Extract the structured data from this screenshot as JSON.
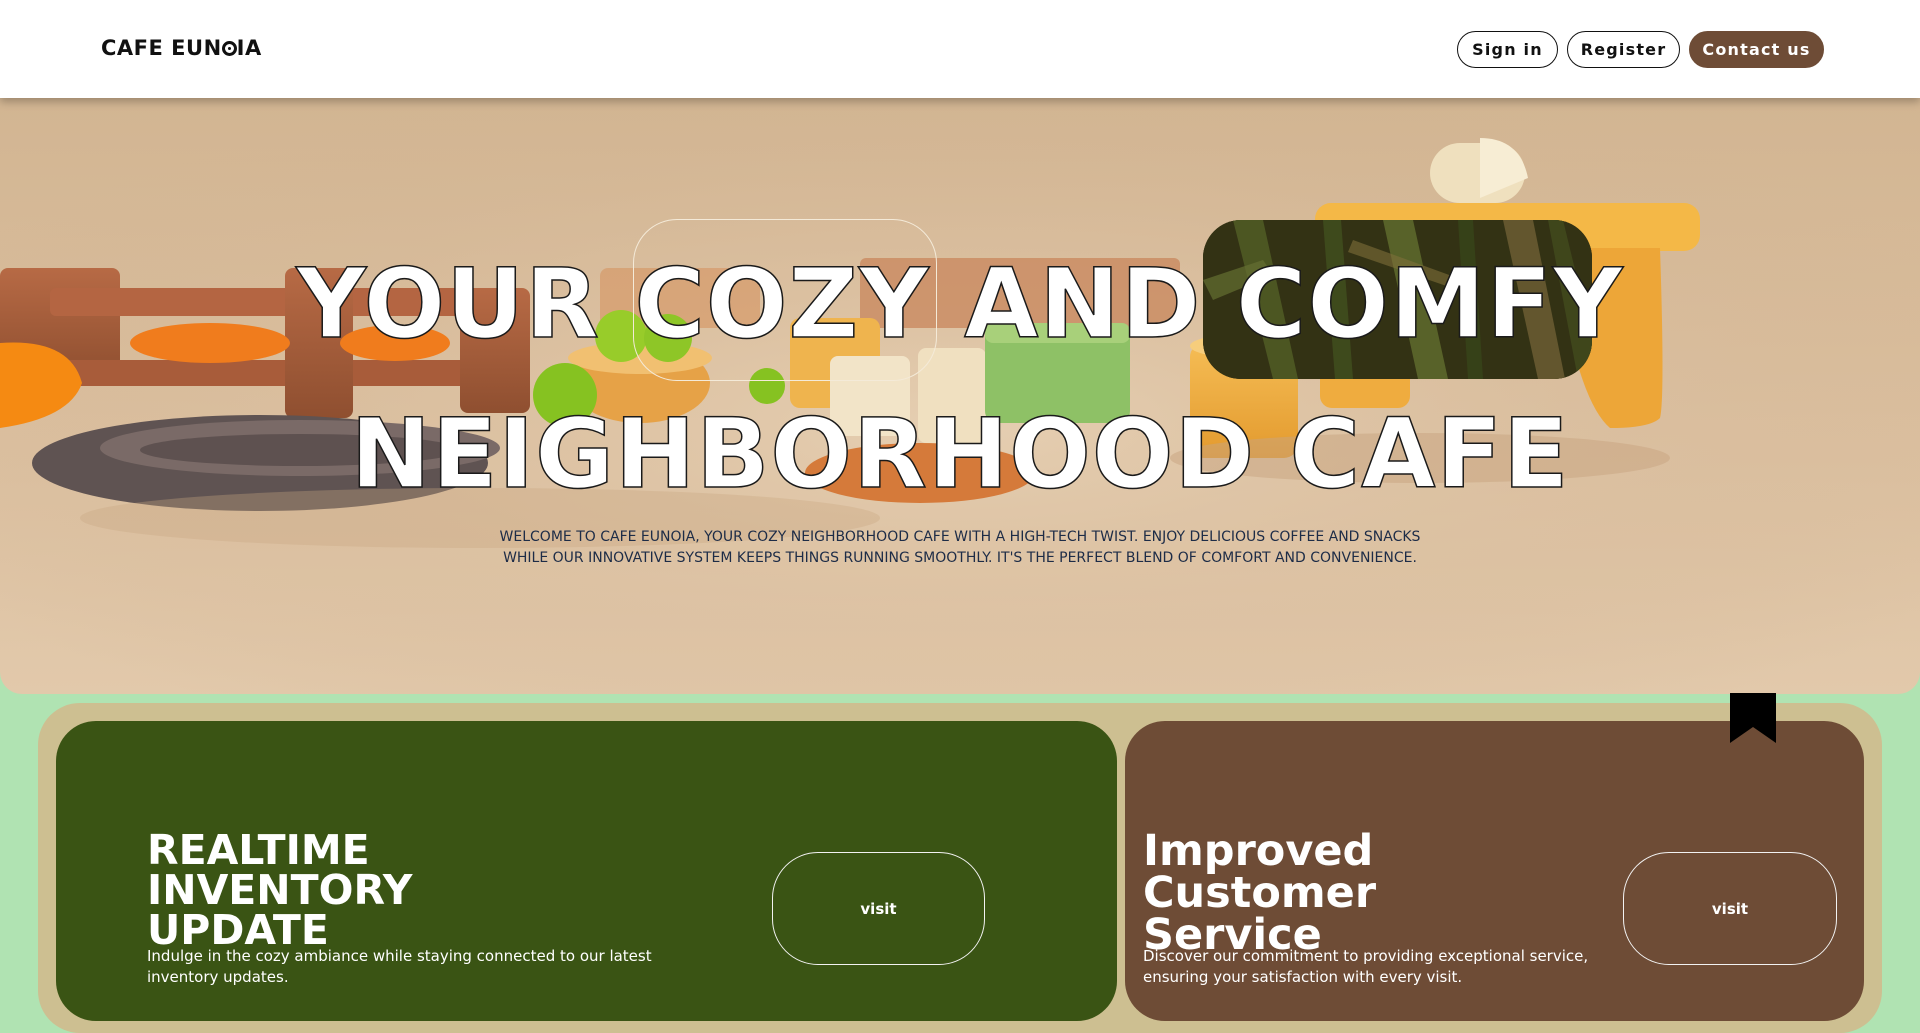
{
  "header": {
    "logo_prefix": "CAFE EUN",
    "logo_suffix": "IA",
    "signin_label": "Sign in",
    "register_label": "Register",
    "contact_label": "Contact us",
    "accent": "#6e4c36"
  },
  "hero": {
    "line1": "YOUR COZY AND COMFY",
    "line2": "NEIGHBORHOOD CAFE",
    "tagline": "WELCOME TO CAFE EUNOIA, YOUR COZY NEIGHBORHOOD CAFE WITH A HIGH-TECH TWIST. ENJOY DELICIOUS COFFEE AND SNACKS WHILE OUR INNOVATIVE SYSTEM KEEPS THINGS RUNNING SMOOTHLY. IT'S THE PERFECT BLEND OF COMFORT AND CONVENIENCE."
  },
  "cards": [
    {
      "title_lines": [
        "REALTIME",
        "INVENTORY",
        "UPDATE"
      ],
      "description": "Indulge in the cozy ambiance while staying connected to our latest inventory updates.",
      "button": "visit",
      "color": "#3a5414"
    },
    {
      "title_lines": [
        "Improved",
        "Customer",
        "Service"
      ],
      "description": "Discover our commitment to providing exceptional service, ensuring your satisfaction with every visit.",
      "button": "visit",
      "color": "#6e4c36"
    }
  ],
  "colors": {
    "page_background": "#b0e3b2",
    "outer_card": "#cdbf91"
  }
}
